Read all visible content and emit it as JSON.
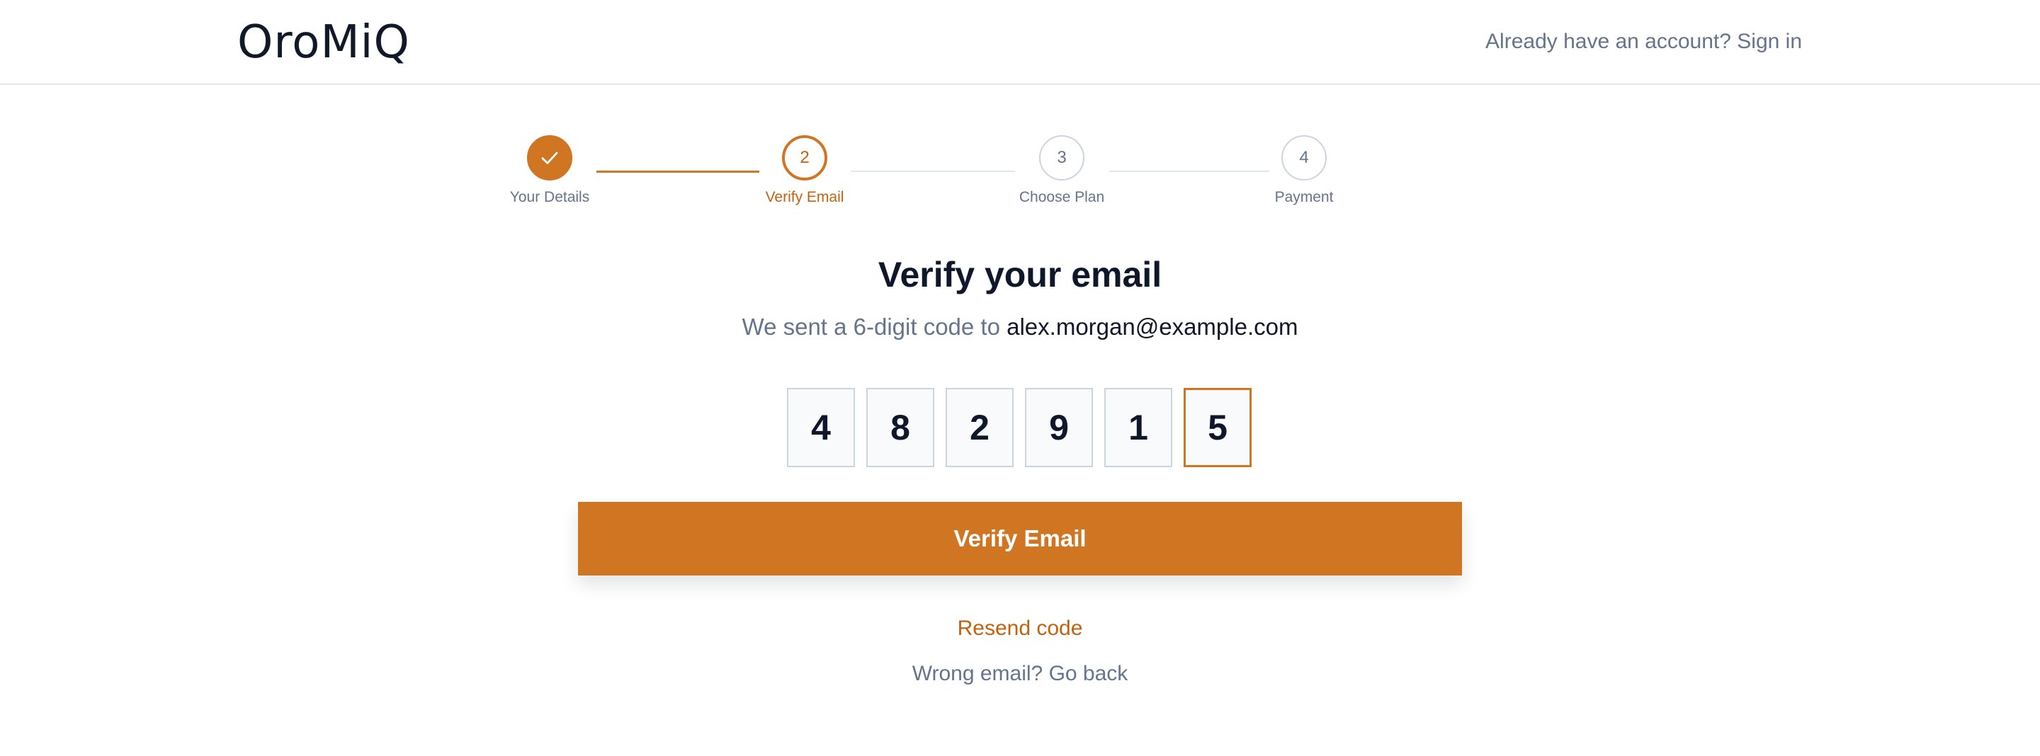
{
  "header": {
    "logo": "OroMiQ",
    "signin_link": "Already have an account? Sign in"
  },
  "stepper": {
    "steps": [
      {
        "number": "",
        "label": "Your Details",
        "state": "completed",
        "icon": "check-icon"
      },
      {
        "number": "2",
        "label": "Verify Email",
        "state": "active"
      },
      {
        "number": "3",
        "label": "Choose Plan",
        "state": "upcoming"
      },
      {
        "number": "4",
        "label": "Payment",
        "state": "upcoming"
      }
    ]
  },
  "main": {
    "title": "Verify your email",
    "subtitle_prefix": "We sent a 6-digit code to",
    "email": "alex.morgan@example.com",
    "code_digits": [
      "4",
      "8",
      "2",
      "9",
      "1",
      "5"
    ],
    "verify_button": "Verify Email",
    "resend_link": "Resend code",
    "go_back_link": "Wrong email? Go back"
  },
  "colors": {
    "accent": "#d07623",
    "accent_text": "#c2620c",
    "heading": "#0f172a",
    "muted": "#64748b",
    "border": "#cbd5e1"
  }
}
